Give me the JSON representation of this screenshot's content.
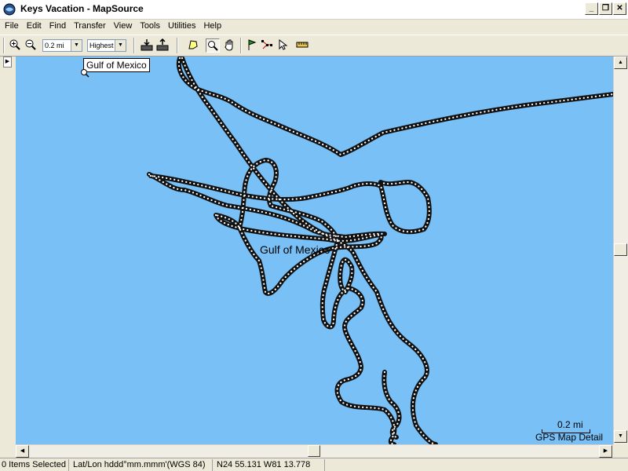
{
  "window": {
    "title": "Keys Vacation - MapSource",
    "buttons": {
      "minimize": "_",
      "restore": "❐",
      "close": "✕"
    }
  },
  "menu": [
    "File",
    "Edit",
    "Find",
    "Transfer",
    "View",
    "Tools",
    "Utilities",
    "Help"
  ],
  "toolbar": {
    "zoom_in_icon": "zoom-in-icon",
    "zoom_out_icon": "zoom-out-icon",
    "scale_value": "0.2 mi",
    "detail_value": "Highest",
    "receive_icon": "receive-from-device-icon",
    "send_icon": "send-to-device-icon",
    "map_tool_icon": "map-tool-icon",
    "zoom_tool_icon": "zoom-tool-icon",
    "hand_tool_icon": "hand-tool-icon",
    "waypoint_tool_icon": "waypoint-flag-icon",
    "route_tool_icon": "route-tool-icon",
    "selection_tool_icon": "selection-arrow-icon",
    "distance_tool_icon": "measure-ruler-icon"
  },
  "map": {
    "background_color": "#79c0f6",
    "track_color": "#111111",
    "tooltip_label": "Gulf of Mexico",
    "water_label": "Gulf of Mexico",
    "scale_label": "0.2 mi",
    "detail_label": "GPS Map Detail"
  },
  "status": {
    "selection": "0 Items Selected",
    "format": "Lat/Lon hddd°mm.mmm'(WGS 84)",
    "position": "N24 55.131 W81 13.778"
  }
}
